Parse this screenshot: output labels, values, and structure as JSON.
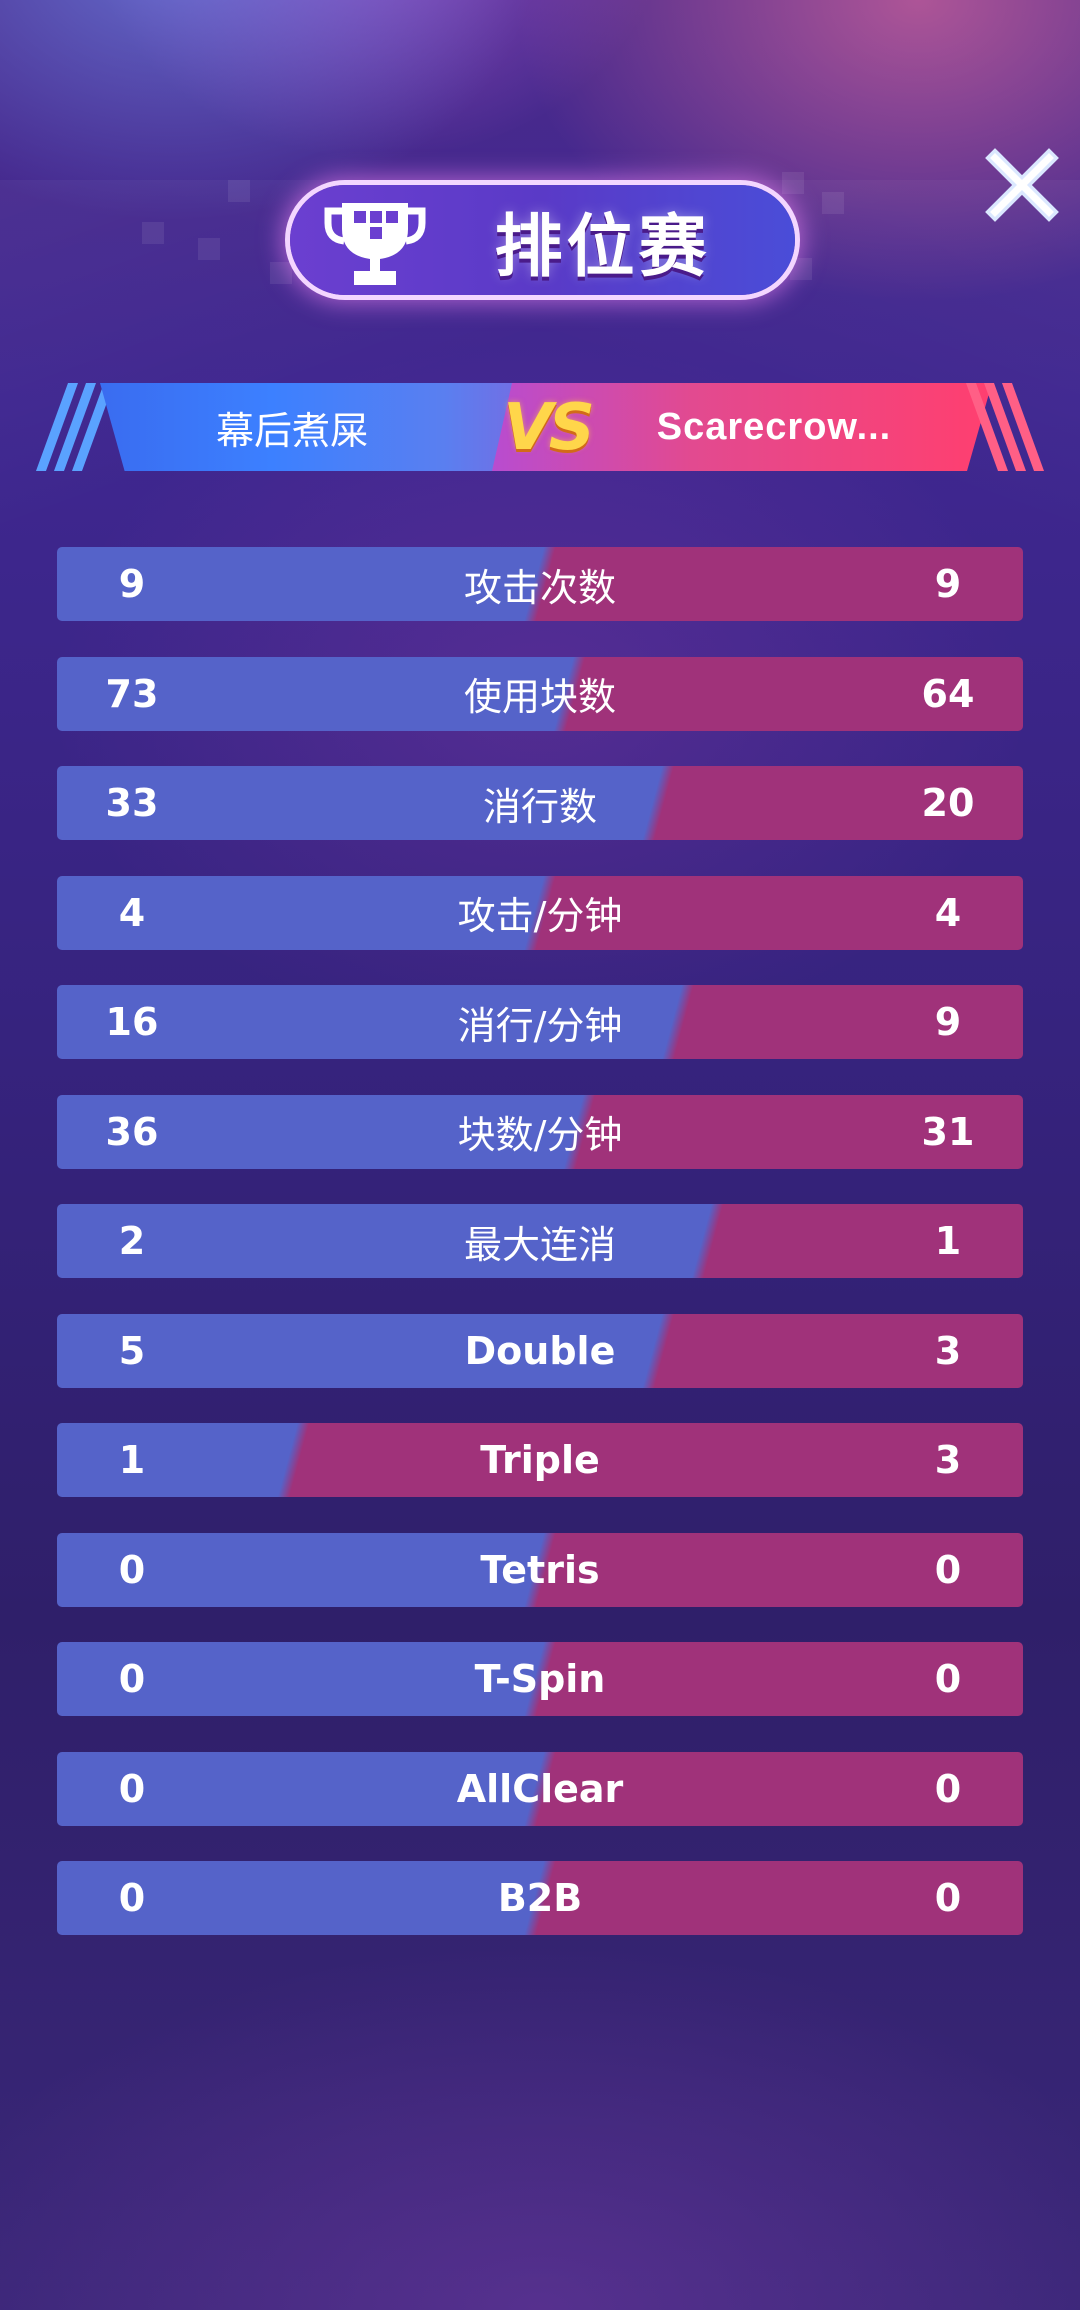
{
  "header": {
    "title": "排位赛",
    "trophy_icon": "trophy-icon",
    "close_icon": "close-icon"
  },
  "versus": {
    "left_player": "幕后煮屎",
    "vs_text": "VS",
    "right_player": "Scarecrow..."
  },
  "colors": {
    "left_bar": "#5563c9",
    "right_bar": "#a0327a",
    "title_banner": "#5a3ac7",
    "vs_gold": "#ffd64a"
  },
  "stats": [
    {
      "label": "攻击次数",
      "left": "9",
      "right": "9",
      "left_share": 0.5
    },
    {
      "label": "使用块数",
      "left": "73",
      "right": "64",
      "left_share": 0.53
    },
    {
      "label": "消行数",
      "left": "33",
      "right": "20",
      "left_share": 0.62
    },
    {
      "label": "攻击/分钟",
      "left": "4",
      "right": "4",
      "left_share": 0.5
    },
    {
      "label": "消行/分钟",
      "left": "16",
      "right": "9",
      "left_share": 0.64
    },
    {
      "label": "块数/分钟",
      "left": "36",
      "right": "31",
      "left_share": 0.54
    },
    {
      "label": "最大连消",
      "left": "2",
      "right": "1",
      "left_share": 0.67
    },
    {
      "label": "Double",
      "left": "5",
      "right": "3",
      "left_share": 0.62
    },
    {
      "label": "Triple",
      "left": "1",
      "right": "3",
      "left_share": 0.25
    },
    {
      "label": "Tetris",
      "left": "0",
      "right": "0",
      "left_share": 0.5
    },
    {
      "label": "T-Spin",
      "left": "0",
      "right": "0",
      "left_share": 0.5
    },
    {
      "label": "AllClear",
      "left": "0",
      "right": "0",
      "left_share": 0.5
    },
    {
      "label": "B2B",
      "left": "0",
      "right": "0",
      "left_share": 0.5
    }
  ]
}
